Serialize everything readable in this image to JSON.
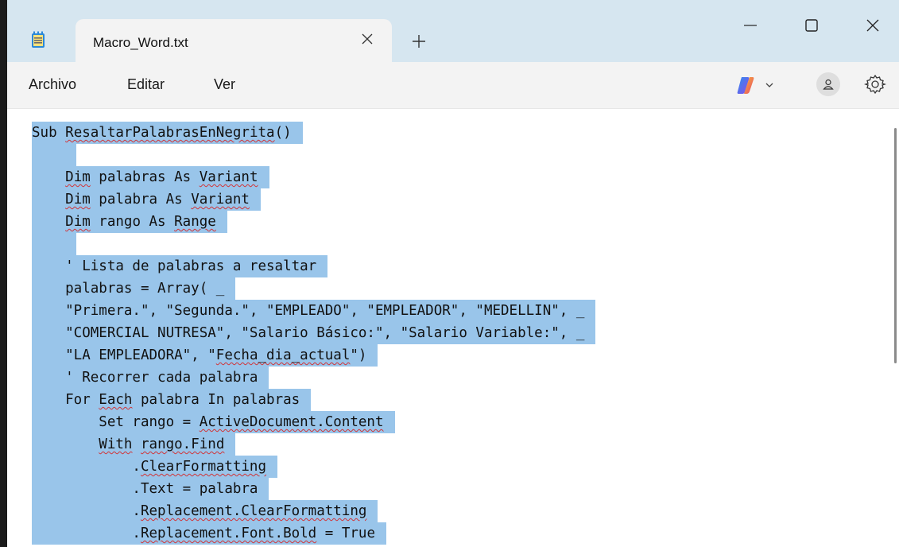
{
  "window": {
    "tab_title": "Macro_Word.txt",
    "tab_close_glyph": "✕",
    "new_tab_glyph": "+"
  },
  "menu": {
    "items": [
      "Archivo",
      "Editar",
      "Ver"
    ]
  },
  "colors": {
    "titlebar": "#d6e6f0",
    "selection": "#99c5ea",
    "spellcheck": "#d13438"
  },
  "editor": {
    "lines": [
      "Sub ResaltarPalabrasEnNegrita()",
      "",
      "    Dim palabras As Variant",
      "    Dim palabra As Variant",
      "    Dim rango As Range",
      "",
      "    ' Lista de palabras a resaltar",
      "    palabras = Array( _",
      "    \"Primera.\", \"Segunda.\", \"EMPLEADO\", \"EMPLEADOR\", \"MEDELLIN\", _",
      "    \"COMERCIAL NUTRESA\", \"Salario Básico:\", \"Salario Variable:\", _",
      "    \"LA EMPLEADORA\", \"Fecha_dia_actual\")",
      "    ' Recorrer cada palabra",
      "    For Each palabra In palabras",
      "        Set rango = ActiveDocument.Content",
      "        With rango.Find",
      "            .ClearFormatting",
      "            .Text = palabra",
      "            .Replacement.ClearFormatting",
      "            .Replacement.Font.Bold = True"
    ],
    "misspelled": [
      "ResaltarPalabrasEnNegrita",
      "Dim",
      "Variant",
      "Range",
      "Fecha_dia_actual",
      "Each",
      "ActiveDocument.Content",
      "With",
      "rango.Find",
      "ClearFormatting",
      "Replacement.ClearFormatting",
      "Replacement.Font.Bold"
    ]
  }
}
